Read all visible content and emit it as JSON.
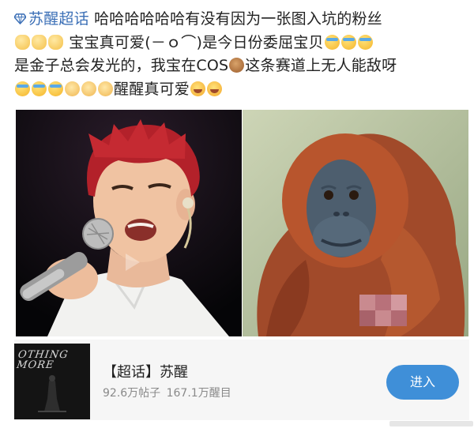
{
  "post": {
    "topic_label": "苏醒超话",
    "line1_text": "哈哈哈哈哈哈有没有因为一张图入坑的粉丝",
    "line2_text": "宝宝真可爱(－ｏ⌒)是今日份委屈宝贝",
    "line3_text_a": "是金子总会发光的，我宝在COS",
    "line3_text_b": "这条赛道上无人能敌呀",
    "line4_text": "醒醒真可爱",
    "emoji_line2_lead": [
      "hand",
      "hand",
      "hand"
    ],
    "emoji_line2_tail": [
      "sweat",
      "sweat",
      "sweat"
    ],
    "emoji_line3": [
      "monkey"
    ],
    "emoji_line4_lead": [
      "sweat",
      "sweat",
      "sweat",
      "cat",
      "cat",
      "cat"
    ],
    "emoji_line4_tail": [
      "sob",
      "sob"
    ]
  },
  "images": {
    "left": "singer-with-microphone",
    "right": "orangutan"
  },
  "card": {
    "thumb_text": "OTHING\nMORE",
    "title": "【超话】苏醒",
    "stats": "92.6万帖子 167.1万醒目",
    "button_label": "进入"
  },
  "colors": {
    "link": "#3b6fb6",
    "button": "#3f8fd8",
    "card_bg": "#f6f6f6",
    "muted_text": "#8a8a8a"
  }
}
